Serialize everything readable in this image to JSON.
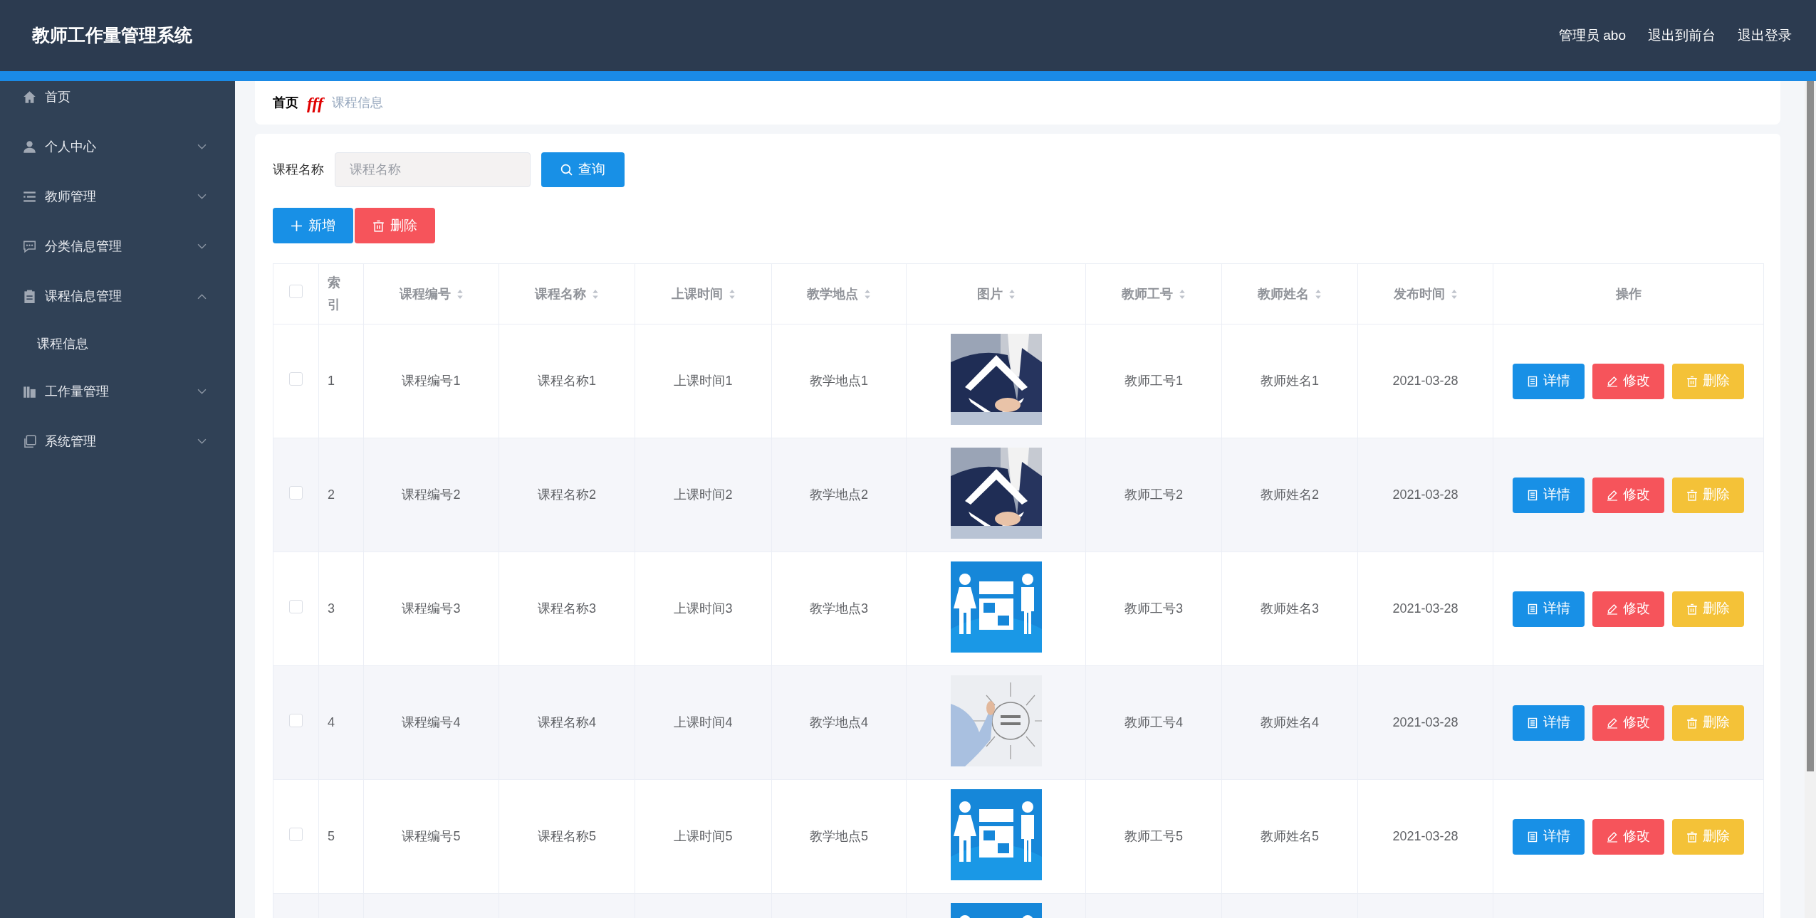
{
  "header": {
    "title": "教师工作量管理系统",
    "links": [
      "管理员 abo",
      "退出到前台",
      "退出登录"
    ]
  },
  "sidebar": {
    "items": [
      {
        "label": "首页",
        "kind": "link"
      },
      {
        "label": "个人中心",
        "kind": "menu",
        "expanded": false
      },
      {
        "label": "教师管理",
        "kind": "menu",
        "expanded": false
      },
      {
        "label": "分类信息管理",
        "kind": "menu",
        "expanded": false
      },
      {
        "label": "课程信息管理",
        "kind": "menu",
        "expanded": true,
        "children": [
          {
            "label": "课程信息"
          }
        ]
      },
      {
        "label": "工作量管理",
        "kind": "menu",
        "expanded": false
      },
      {
        "label": "系统管理",
        "kind": "menu",
        "expanded": false
      }
    ]
  },
  "breadcrumb": {
    "items": [
      "首页",
      "课程信息"
    ],
    "separator": "fff"
  },
  "search": {
    "label": "课程名称",
    "placeholder": "课程名称",
    "button": "查询"
  },
  "toolbar": [
    {
      "label": "新增",
      "kind": "add"
    },
    {
      "label": "删除",
      "kind": "delete"
    }
  ],
  "table": {
    "select_all": {
      "checked": false
    },
    "columns": [
      {
        "label": "索引",
        "sortable": false
      },
      {
        "label": "课程编号",
        "sortable": true
      },
      {
        "label": "课程名称",
        "sortable": true
      },
      {
        "label": "上课时间",
        "sortable": true
      },
      {
        "label": "教学地点",
        "sortable": true
      },
      {
        "label": "图片",
        "sortable": true
      },
      {
        "label": "教师工号",
        "sortable": true
      },
      {
        "label": "教师姓名",
        "sortable": true
      },
      {
        "label": "发布时间",
        "sortable": true
      },
      {
        "label": "操作",
        "sortable": false
      }
    ],
    "rows": [
      {
        "checked": false,
        "cells": [
          "1",
          "课程编号1",
          "课程名称1",
          "上课时间1",
          "教学地点1"
        ],
        "image": {
          "kind": "picture"
        },
        "cells_after": [
          "教师工号1",
          "教师姓名1",
          "2021-03-28"
        ],
        "actions": [
          {
            "label": "详情",
            "kind": "detail"
          },
          {
            "label": "修改",
            "kind": "edit"
          },
          {
            "label": "删除",
            "kind": "delete"
          }
        ]
      },
      {
        "checked": false,
        "cells": [
          "2",
          "课程编号2",
          "课程名称2",
          "上课时间2",
          "教学地点2"
        ],
        "image": {
          "kind": "picture"
        },
        "cells_after": [
          "教师工号2",
          "教师姓名2",
          "2021-03-28"
        ],
        "actions": [
          {
            "label": "详情",
            "kind": "detail"
          },
          {
            "label": "修改",
            "kind": "edit"
          },
          {
            "label": "删除",
            "kind": "delete"
          }
        ]
      },
      {
        "checked": false,
        "cells": [
          "3",
          "课程编号3",
          "课程名称3",
          "上课时间3",
          "教学地点3"
        ],
        "image": {
          "kind": "picture"
        },
        "cells_after": [
          "教师工号3",
          "教师姓名3",
          "2021-03-28"
        ],
        "actions": [
          {
            "label": "详情",
            "kind": "detail"
          },
          {
            "label": "修改",
            "kind": "edit"
          },
          {
            "label": "删除",
            "kind": "delete"
          }
        ]
      },
      {
        "checked": false,
        "cells": [
          "4",
          "课程编号4",
          "课程名称4",
          "上课时间4",
          "教学地点4"
        ],
        "image": {
          "kind": "picture"
        },
        "cells_after": [
          "教师工号4",
          "教师姓名4",
          "2021-03-28"
        ],
        "actions": [
          {
            "label": "详情",
            "kind": "detail"
          },
          {
            "label": "修改",
            "kind": "edit"
          },
          {
            "label": "删除",
            "kind": "delete"
          }
        ]
      },
      {
        "checked": false,
        "cells": [
          "5",
          "课程编号5",
          "课程名称5",
          "上课时间5",
          "教学地点5"
        ],
        "image": {
          "kind": "picture"
        },
        "cells_after": [
          "教师工号5",
          "教师姓名5",
          "2021-03-28"
        ],
        "actions": [
          {
            "label": "详情",
            "kind": "detail"
          },
          {
            "label": "修改",
            "kind": "edit"
          },
          {
            "label": "删除",
            "kind": "delete"
          }
        ]
      },
      {
        "image": {
          "kind": "picture"
        }
      }
    ]
  }
}
